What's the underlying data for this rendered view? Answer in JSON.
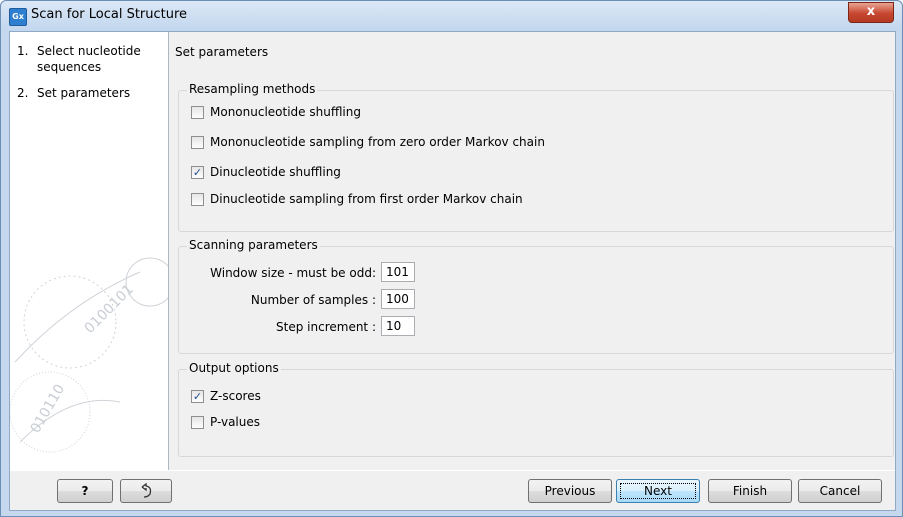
{
  "window": {
    "title": "Scan for Local Structure",
    "app_icon_text": "Gx",
    "close_glyph": "x"
  },
  "steps": [
    {
      "number": "1.",
      "label_line1": "Select nucleotide",
      "label_line2": "sequences"
    },
    {
      "number": "2.",
      "label_line1": "Set parameters"
    }
  ],
  "main": {
    "heading": "Set parameters",
    "resampling": {
      "title": "Resampling methods",
      "options": [
        {
          "label": "Mononucleotide shuffling",
          "checked": false
        },
        {
          "label": "Mononucleotide sampling from zero order Markov chain",
          "checked": false
        },
        {
          "label": "Dinucleotide shuffling",
          "checked": true
        },
        {
          "label": "Dinucleotide sampling from first order Markov chain",
          "checked": false
        }
      ]
    },
    "scanning": {
      "title": "Scanning parameters",
      "window_size_label": "Window size - must be odd:",
      "window_size_value": "101",
      "samples_label": "Number of samples :",
      "samples_value": "100",
      "step_label": "Step increment :",
      "step_value": "10"
    },
    "output": {
      "title": "Output options",
      "options": [
        {
          "label": "Z-scores",
          "checked": true
        },
        {
          "label": "P-values",
          "checked": false
        }
      ]
    }
  },
  "footer": {
    "help_label": "?",
    "previous_label": "Previous",
    "next_label": "Next",
    "finish_label": "Finish",
    "cancel_label": "Cancel"
  },
  "icons": {
    "help": "question-mark",
    "reset": "reset-arrow-icon",
    "close": "close-icon"
  }
}
